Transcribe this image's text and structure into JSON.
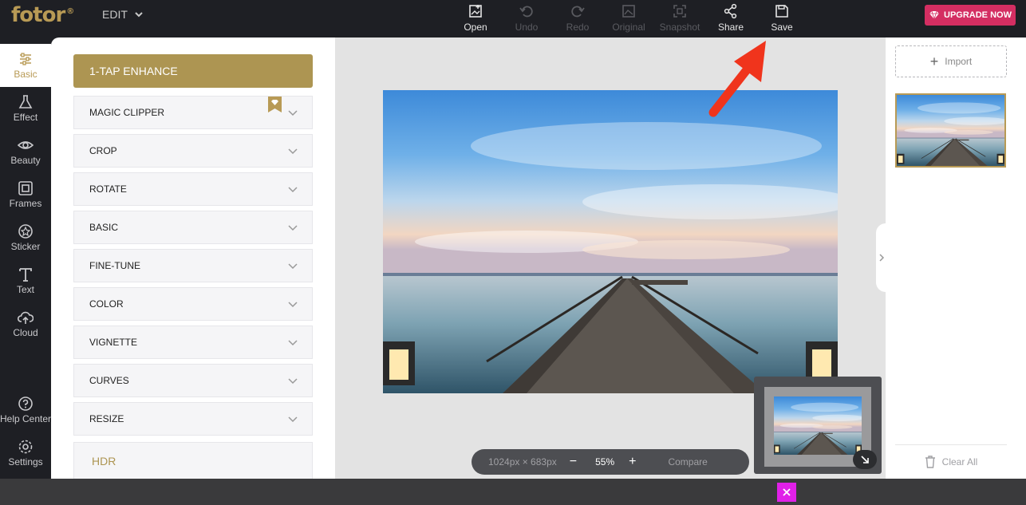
{
  "app": {
    "logo": "fotor",
    "registered": "®",
    "edit_menu": "EDIT"
  },
  "toolbar": {
    "tools": [
      {
        "label": "Open",
        "icon": "open-image-icon",
        "enabled": true
      },
      {
        "label": "Undo",
        "icon": "undo-icon",
        "enabled": false
      },
      {
        "label": "Redo",
        "icon": "redo-icon",
        "enabled": false
      },
      {
        "label": "Original",
        "icon": "original-icon",
        "enabled": false
      },
      {
        "label": "Snapshot",
        "icon": "snapshot-icon",
        "enabled": false
      },
      {
        "label": "Share",
        "icon": "share-icon",
        "enabled": true
      },
      {
        "label": "Save",
        "icon": "save-icon",
        "enabled": true
      }
    ],
    "upgrade_label": "UPGRADE NOW"
  },
  "sidebar": {
    "items": [
      {
        "label": "Basic",
        "icon": "sliders-icon",
        "active": true
      },
      {
        "label": "Effect",
        "icon": "flask-icon"
      },
      {
        "label": "Beauty",
        "icon": "eye-icon"
      },
      {
        "label": "Frames",
        "icon": "frame-icon"
      },
      {
        "label": "Sticker",
        "icon": "sticker-icon"
      },
      {
        "label": "Text",
        "icon": "text-icon"
      },
      {
        "label": "Cloud",
        "icon": "cloud-upload-icon"
      },
      {
        "label": "Help Center",
        "icon": "help-icon"
      },
      {
        "label": "Settings",
        "icon": "gear-icon"
      }
    ]
  },
  "panel": {
    "enhance_label": "1-TAP ENHANCE",
    "sections": [
      "MAGIC CLIPPER",
      "CROP",
      "ROTATE",
      "BASIC",
      "FINE-TUNE",
      "COLOR",
      "VIGNETTE",
      "CURVES",
      "RESIZE"
    ],
    "hdr_label": "HDR"
  },
  "canvas": {
    "dimensions": "1024px × 683px",
    "minus": "−",
    "zoom": "55%",
    "plus": "+",
    "compare": "Compare"
  },
  "right_panel": {
    "import_label": "Import",
    "clear_label": "Clear All"
  },
  "colors": {
    "accent": "#ad9552",
    "upgrade": "#d42e62",
    "dark": "#1e1f24",
    "arrow": "#f0341c"
  }
}
